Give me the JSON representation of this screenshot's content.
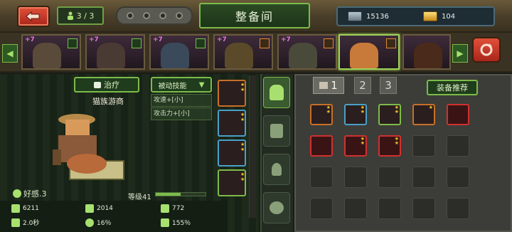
{
  "header": {
    "back_icon": "back-arrow-icon",
    "squad_count": "3 / 3",
    "title": "整备间",
    "currency_1_value": "15136",
    "currency_2_value": "104"
  },
  "hero_strip": {
    "heroes": [
      {
        "level": "+7",
        "badge": "person"
      },
      {
        "level": "+7",
        "badge": "person"
      },
      {
        "level": "+7",
        "badge": "person"
      },
      {
        "level": "+7",
        "badge": "mixed"
      },
      {
        "level": "+7",
        "badge": "mixed"
      },
      {
        "level": "",
        "badge": "mixed"
      },
      {
        "level": "",
        "badge": "none"
      }
    ],
    "selected_index": 5
  },
  "character": {
    "heal_label": "治疗",
    "name": "猫族游商",
    "passive_label": "被动技能",
    "skills": [
      "攻速+[小]",
      "攻击力+[小]"
    ],
    "affinity": "好感.3",
    "level": "等级41",
    "xp_fraction": 0.5
  },
  "stats": {
    "hp": "6211",
    "power": "2014",
    "defense": "772",
    "attack_speed": "2.0秒",
    "crit": "16％",
    "crit_damage": "155％"
  },
  "equip_slots": [
    {
      "color": "orange",
      "stars": 2
    },
    {
      "color": "blue",
      "stars": 2
    },
    {
      "color": "orange",
      "stars": 2
    },
    {
      "color": "green",
      "stars": 2
    }
  ],
  "side_tabs": [
    "bot-icon",
    "gear-icon",
    "lightbulb-icon",
    "heart-person-icon"
  ],
  "inventory": {
    "page_tabs": [
      "1",
      "2",
      "3"
    ],
    "recommend_label": "装备推荐",
    "items": [
      {
        "color": "orange",
        "stars": 2
      },
      {
        "color": "orange",
        "stars": 2
      },
      {
        "color": "green",
        "stars": 2
      },
      {
        "color": "orange",
        "stars": 1
      },
      {
        "color": "red",
        "stars": 0
      },
      {
        "color": "red",
        "stars": 0
      },
      {
        "color": "red",
        "stars": 2
      },
      {
        "color": "red",
        "stars": 2
      },
      {
        "color": "empty"
      },
      {
        "color": "empty"
      }
    ]
  }
}
